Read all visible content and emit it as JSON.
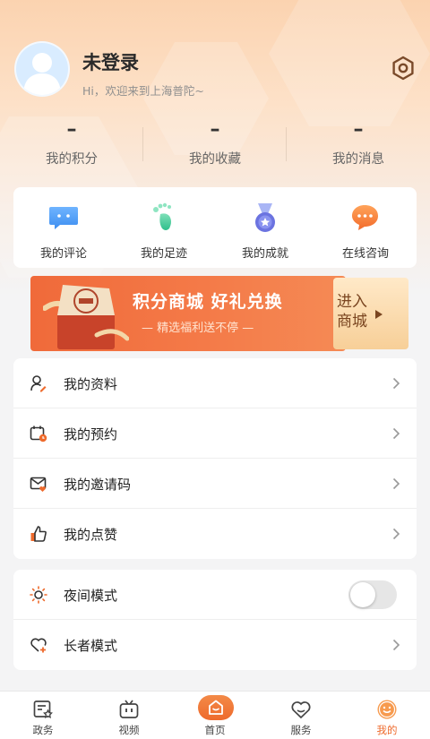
{
  "profile": {
    "username": "未登录",
    "greeting": "Hi，欢迎来到上海普陀~"
  },
  "stats": [
    {
      "value": "–",
      "label": "我的积分"
    },
    {
      "value": "–",
      "label": "我的收藏"
    },
    {
      "value": "–",
      "label": "我的消息"
    }
  ],
  "quick_actions": [
    {
      "label": "我的评论",
      "icon": "comment-bubble-icon"
    },
    {
      "label": "我的足迹",
      "icon": "footprint-icon"
    },
    {
      "label": "我的成就",
      "icon": "medal-icon"
    },
    {
      "label": "在线咨询",
      "icon": "chat-icon"
    }
  ],
  "banner": {
    "title": "积分商城 好礼兑换",
    "subtitle": "— 精选福利送不停 —",
    "enter_line1": "进入",
    "enter_line2": "商城"
  },
  "menu_primary": [
    {
      "label": "我的资料",
      "icon": "profile-edit-icon"
    },
    {
      "label": "我的预约",
      "icon": "calendar-clock-icon"
    },
    {
      "label": "我的邀请码",
      "icon": "mail-heart-icon"
    },
    {
      "label": "我的点赞",
      "icon": "thumbs-up-icon"
    }
  ],
  "menu_secondary": {
    "night_mode": {
      "label": "夜间模式",
      "enabled": false
    },
    "elder_mode": {
      "label": "长者模式"
    }
  },
  "tabbar": [
    {
      "label": "政务",
      "icon": "government-icon"
    },
    {
      "label": "视频",
      "icon": "tv-icon"
    },
    {
      "label": "首页",
      "icon": "home-icon"
    },
    {
      "label": "服务",
      "icon": "heart-service-icon"
    },
    {
      "label": "我的",
      "icon": "smile-icon",
      "active": true
    }
  ],
  "colors": {
    "accent": "#ee6a2c",
    "banner_red": "#f06a3a",
    "banner_gold": "#f7cf98"
  }
}
